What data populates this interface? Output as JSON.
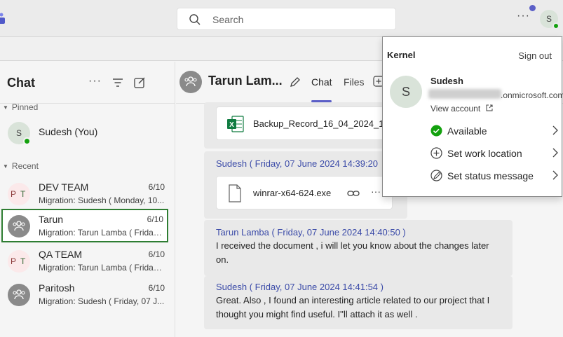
{
  "topbar": {
    "search_placeholder": "Search",
    "more_label": "···",
    "avatar_initial": "S"
  },
  "sidebar": {
    "title": "Chat",
    "more_label": "···",
    "pinned_label": "Pinned",
    "recent_label": "Recent",
    "pinned": [
      {
        "name": "Sudesh (You)",
        "initial": "S"
      }
    ],
    "recent": [
      {
        "name": "DEV TEAM",
        "date": "6/10",
        "preview": "Migration: Sudesh ( Monday, 10...",
        "initials": [
          "P",
          "T"
        ]
      },
      {
        "name": "Tarun",
        "date": "6/10",
        "preview": "Migration: Tarun Lamba ( Friday,..."
      },
      {
        "name": "QA TEAM",
        "date": "6/10",
        "preview": "Migration: Tarun Lamba ( Friday,...",
        "initials": [
          "P",
          "T"
        ]
      },
      {
        "name": "Paritosh",
        "date": "6/10",
        "preview": "Migration: Sudesh ( Friday, 07 J..."
      }
    ]
  },
  "main": {
    "chat_name": "Tarun Lam...",
    "tabs": [
      {
        "label": "Chat"
      },
      {
        "label": "Files"
      }
    ],
    "messages": [
      {
        "file_name": "Backup_Record_16_04_2024_1"
      },
      {
        "meta": "Sudesh ( Friday, 07 June 2024 14:39:20",
        "file_name": "winrar-x64-624.exe"
      },
      {
        "meta": "Tarun Lamba ( Friday, 07 June 2024 14:40:50 )",
        "body": "I received the document , i will let you know about the changes later on."
      },
      {
        "meta": "Sudesh ( Friday, 07 June 2024 14:41:54 )",
        "body": "Great. Also , I found an interesting article related to our project that I thought you might find useful. I''ll attach it as well ."
      }
    ]
  },
  "profile_panel": {
    "org": "Kernel",
    "sign_out": "Sign out",
    "initial": "S",
    "name": "Sudesh",
    "email_visible": ".onmicrosoft.com",
    "view_account": "View account",
    "items": [
      {
        "label": "Available",
        "icon": "available-status-icon",
        "color": "#13a10e"
      },
      {
        "label": "Set work location",
        "icon": "location-icon"
      },
      {
        "label": "Set status message",
        "icon": "edit-status-icon"
      }
    ]
  },
  "colors": {
    "accent": "#5b5fc7",
    "presence_available": "#13a10e",
    "message_meta": "#3b4ba8",
    "active_row_border": "#2e7d32"
  }
}
